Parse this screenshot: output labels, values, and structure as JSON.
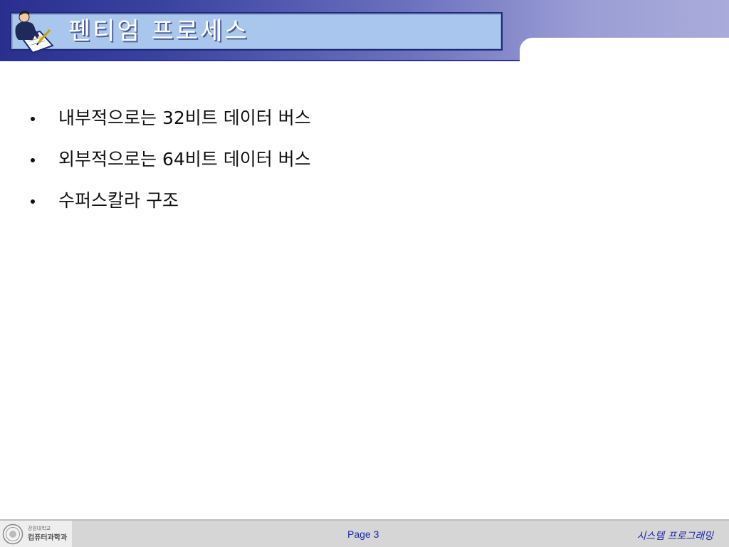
{
  "slide": {
    "title": "펜티엄 프로세스",
    "bullets": [
      "내부적으로는 32비트 데이터 버스",
      "외부적으로는 64비트 데이터 버스",
      "수퍼스칼라 구조"
    ]
  },
  "footer": {
    "school": "강원대학교",
    "department": "컴퓨터과학과",
    "page": "Page 3",
    "course": "시스템 프로그래밍"
  },
  "icons": {
    "title_logo": "businessman-writing-icon",
    "footer_logo": "university-seal-icon"
  },
  "colors": {
    "header_dark": "#2a2f8f",
    "header_light": "#a9acda",
    "title_box": "#a9c7ec",
    "footer_text": "#1b2aa6",
    "footer_bg": "#d6d6d6"
  }
}
